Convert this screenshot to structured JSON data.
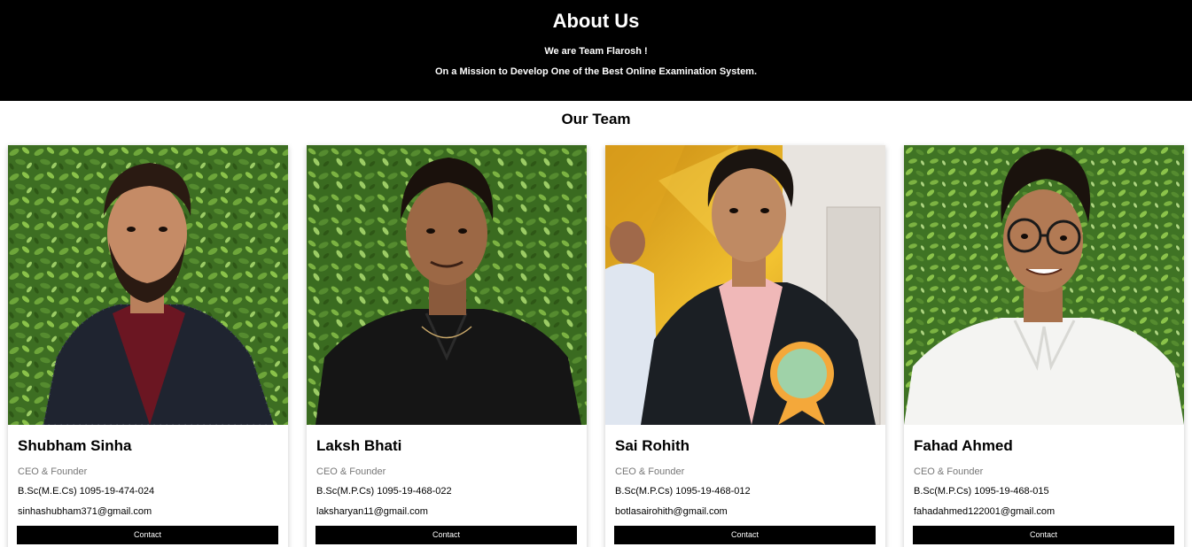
{
  "header": {
    "title": "About Us",
    "line1": "We are Team Flarosh !",
    "line2": "On a Mission to Develop One of the Best Online Examination System."
  },
  "team": {
    "heading": "Our Team",
    "members": [
      {
        "name": "Shubham Sinha",
        "role": "CEO & Founder",
        "degree": "B.Sc(M.E.Cs) 1095-19-474-024",
        "email": "sinhashubham371@gmail.com",
        "button": "Contact",
        "background": "green-foliage",
        "outfit": "dark polka-dot blazer, maroon shirt"
      },
      {
        "name": "Laksh Bhati",
        "role": "CEO & Founder",
        "degree": "B.Sc(M.P.Cs) 1095-19-468-022",
        "email": "laksharyan11@gmail.com",
        "button": "Contact",
        "background": "green-foliage",
        "outfit": "black shirt"
      },
      {
        "name": "Sai Rohith",
        "role": "CEO & Founder",
        "degree": "B.Sc(M.P.Cs) 1095-19-468-012",
        "email": "botlasairohith@gmail.com",
        "button": "Contact",
        "background": "yellow-event-hall",
        "outfit": "black blazer, pink shirt, rosette badge"
      },
      {
        "name": "Fahad Ahmed",
        "role": "CEO & Founder",
        "degree": "B.Sc(M.P.Cs) 1095-19-468-015",
        "email": "fahadahmed122001@gmail.com",
        "button": "Contact",
        "background": "green-foliage",
        "outfit": "white shirt, round glasses"
      }
    ]
  },
  "colors": {
    "header_bg": "#000000",
    "header_text": "#ffffff",
    "button_bg": "#000000",
    "role_text": "#777777",
    "foliage_dark": "#2f5a1c",
    "foliage_light": "#6ea63a"
  }
}
